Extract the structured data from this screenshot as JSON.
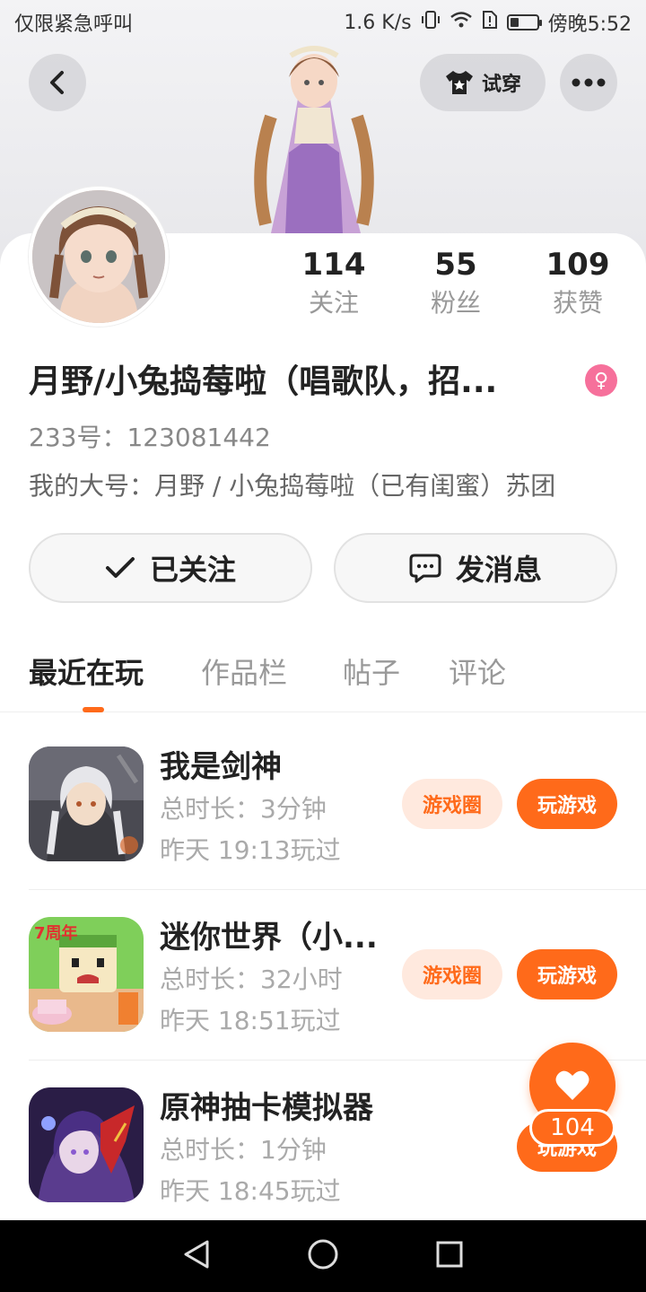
{
  "status_bar": {
    "left_text": "仅限紧急呼叫",
    "speed": "1.6 K/s",
    "time": "傍晚5:52"
  },
  "header": {
    "try_on_label": "试穿"
  },
  "profile": {
    "stats": [
      {
        "value": "114",
        "label": "关注"
      },
      {
        "value": "55",
        "label": "粉丝"
      },
      {
        "value": "109",
        "label": "获赞"
      }
    ],
    "name": "月野/小兔捣莓啦（唱歌队，招...",
    "uid": "233号：123081442",
    "bio": "我的大号：月野 / 小兔捣莓啦（已有闺蜜）苏团",
    "gender_symbol": "♀",
    "followed_label": "已关注",
    "message_label": "发消息"
  },
  "tabs": [
    {
      "label": "最近在玩"
    },
    {
      "label": "作品栏"
    },
    {
      "label": "帖子"
    },
    {
      "label": "评论"
    }
  ],
  "games": [
    {
      "title": "我是剑神",
      "duration": "总时长：3分钟",
      "last_played": "昨天 19:13玩过",
      "circle_label": "游戏圈",
      "play_label": "玩游戏"
    },
    {
      "title": "迷你世界（小...",
      "duration": "总时长：32小时",
      "last_played": "昨天 18:51玩过",
      "circle_label": "游戏圈",
      "play_label": "玩游戏",
      "icon_badge": "7周年"
    },
    {
      "title": "原神抽卡模拟器",
      "duration": "总时长：1分钟",
      "last_played": "昨天 18:45玩过",
      "play_label": "玩游戏"
    }
  ],
  "fab": {
    "count": "104"
  },
  "colors": {
    "accent": "#ff6a1a",
    "accent_light": "#ffe9de",
    "gender": "#f6709b"
  }
}
